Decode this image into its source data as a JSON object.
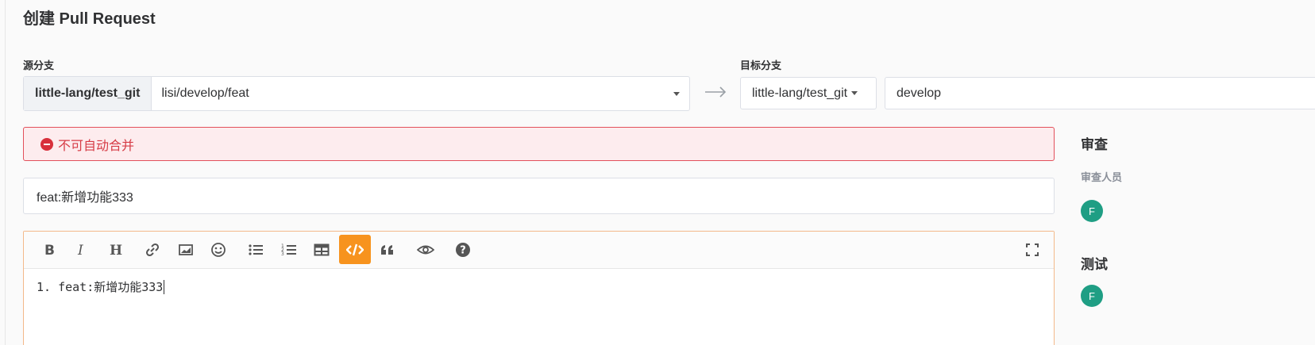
{
  "page": {
    "title": "创建 Pull Request"
  },
  "source": {
    "label": "源分支",
    "repo": "little-lang/test_git",
    "branch": "lisi/develop/feat"
  },
  "target": {
    "label": "目标分支",
    "repo": "little-lang/test_git",
    "branch": "develop"
  },
  "alert": {
    "text": "不可自动合并"
  },
  "pr_title": {
    "value": "feat:新增功能333"
  },
  "editor": {
    "content": "1. feat:新增功能333",
    "toolbar": [
      "bold-icon",
      "italic-icon",
      "heading-icon",
      "link-icon",
      "image-icon",
      "emoji-icon",
      "bullet-list-icon",
      "numbered-list-icon",
      "table-icon",
      "code-icon",
      "quote-icon",
      "preview-eye-icon",
      "help-icon",
      "fullscreen-icon"
    ],
    "active_tool": "code-icon",
    "accent": "#f7931e"
  },
  "sidebar": {
    "review_heading": "审查",
    "reviewers_label": "审查人员",
    "reviewer_avatar": "F",
    "test_heading": "测试",
    "tester_avatar": "F",
    "avatar_color": "#1f9e84"
  },
  "colors": {
    "alert_border": "#e2505b",
    "alert_bg": "#fdecee",
    "alert_text": "#d63b45"
  }
}
